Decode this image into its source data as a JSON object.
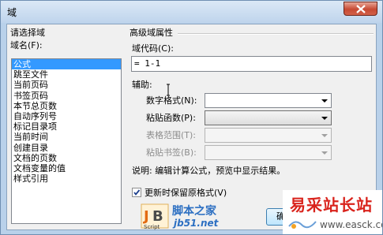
{
  "window": {
    "title": "域"
  },
  "left": {
    "group_label": "请选择域",
    "field_names_label": "域名(F):",
    "field_names": [
      "公式",
      "跳至文件",
      "当前页码",
      "书签页码",
      "本节总页数",
      "自动序列号",
      "标记目录项",
      "当前时间",
      "创建目录",
      "文档的页数",
      "文档变量的值",
      "样式引用"
    ],
    "selected_index": 0
  },
  "right": {
    "group_label": "高级域属性",
    "field_code_label": "域代码(C):",
    "field_code_value": "= 1-1",
    "aux_label": "辅助:",
    "number_format_label": "数字格式(N):",
    "number_format_value": "",
    "paste_function_label": "粘贴函数(P):",
    "paste_function_value": "",
    "table_range_label": "表格范围(T):",
    "table_range_value": "",
    "paste_bookmark_label": "粘贴书签(B):",
    "paste_bookmark_value": "",
    "description": "说明: 编辑计算公式，预览中显示结果。",
    "preserve_format_label": "更新时保留原格式(V)",
    "preserve_format_checked": true,
    "ok_button": "确定"
  },
  "watermark_left": {
    "site_name": "脚本之家",
    "url": "jb51.net",
    "script_tag": "Script"
  },
  "watermark_right": {
    "site_name": "易采站长站",
    "url": "www.easck.com"
  },
  "colors": {
    "selection": "#3399ff",
    "dialog_bg": "#f0f0f0",
    "close_button": "#c74a33",
    "watermark_blue": "#2c6fc2",
    "watermark_red": "#d9231c"
  },
  "icons": [
    "close-icon",
    "dropdown-arrow-icon",
    "checkmark-icon",
    "jb51-logo-icon",
    "text-cursor-icon"
  ]
}
